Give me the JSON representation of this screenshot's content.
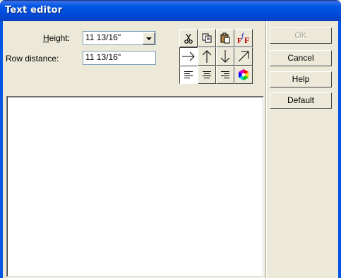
{
  "window": {
    "title": "Text editor"
  },
  "form": {
    "height_label": "Height:",
    "height_label_first": "H",
    "height_label_rest": "eight:",
    "height_value": "11 13/16\"",
    "row_distance_label": "Row distance:",
    "row_distance_value": "11 13/16\""
  },
  "toolbar": {
    "row1": [
      "cut-icon",
      "copy-icon",
      "paste-icon",
      "font-icon"
    ],
    "row2": [
      "arrow-right-icon",
      "arrow-up-icon",
      "arrow-down-icon",
      "arrow-diagonal-up-right-icon"
    ],
    "row3": [
      "align-left-icon",
      "align-center-icon",
      "align-right-icon",
      "color-icon"
    ],
    "font_glyph": "F",
    "font_glyph_small": "f"
  },
  "buttons": {
    "ok": "OK",
    "cancel": "Cancel",
    "help": "Help",
    "default": "Default"
  },
  "colors": {
    "title_bar": "#0058e6",
    "window_bg": "#ece9d8",
    "title_text": "#ffffff"
  }
}
